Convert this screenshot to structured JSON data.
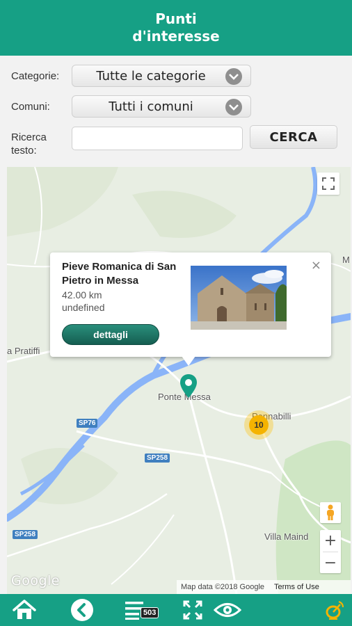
{
  "header": {
    "title": "Punti d'interesse"
  },
  "filters": {
    "category_label": "Categorie:",
    "category_value": "Tutte le categorie",
    "municipality_label": "Comuni:",
    "municipality_value": "Tutti i comuni",
    "search_label": "Ricerca testo:",
    "search_value": "",
    "search_button": "CERCA"
  },
  "map": {
    "places": {
      "left": "a Pratiffi",
      "ponte": "Ponte Messa",
      "pennabilli": "Pennabilli",
      "villa": "Villa Maind",
      "edge": "M"
    },
    "roads": [
      "SP76",
      "SP258",
      "SP258"
    ],
    "cluster_count": "10",
    "google": "Google",
    "attribution": "Map data ©2018 Google",
    "terms": "Terms of Use",
    "zoom_in": "+",
    "zoom_out": "−",
    "colors": {
      "accent": "#16a085",
      "cluster": "#f5b301",
      "water": "#8ab4f8"
    }
  },
  "infowindow": {
    "title": "Pieve Romanica di San Pietro in Messa",
    "distance": "42.00 km",
    "extra": "undefined",
    "button": "dettagli",
    "close": "×"
  },
  "nav": {
    "count": "503",
    "icons": [
      "home-icon",
      "back-icon",
      "list-icon",
      "fullscreen-icon",
      "eye-icon",
      "satellite-icon"
    ]
  }
}
